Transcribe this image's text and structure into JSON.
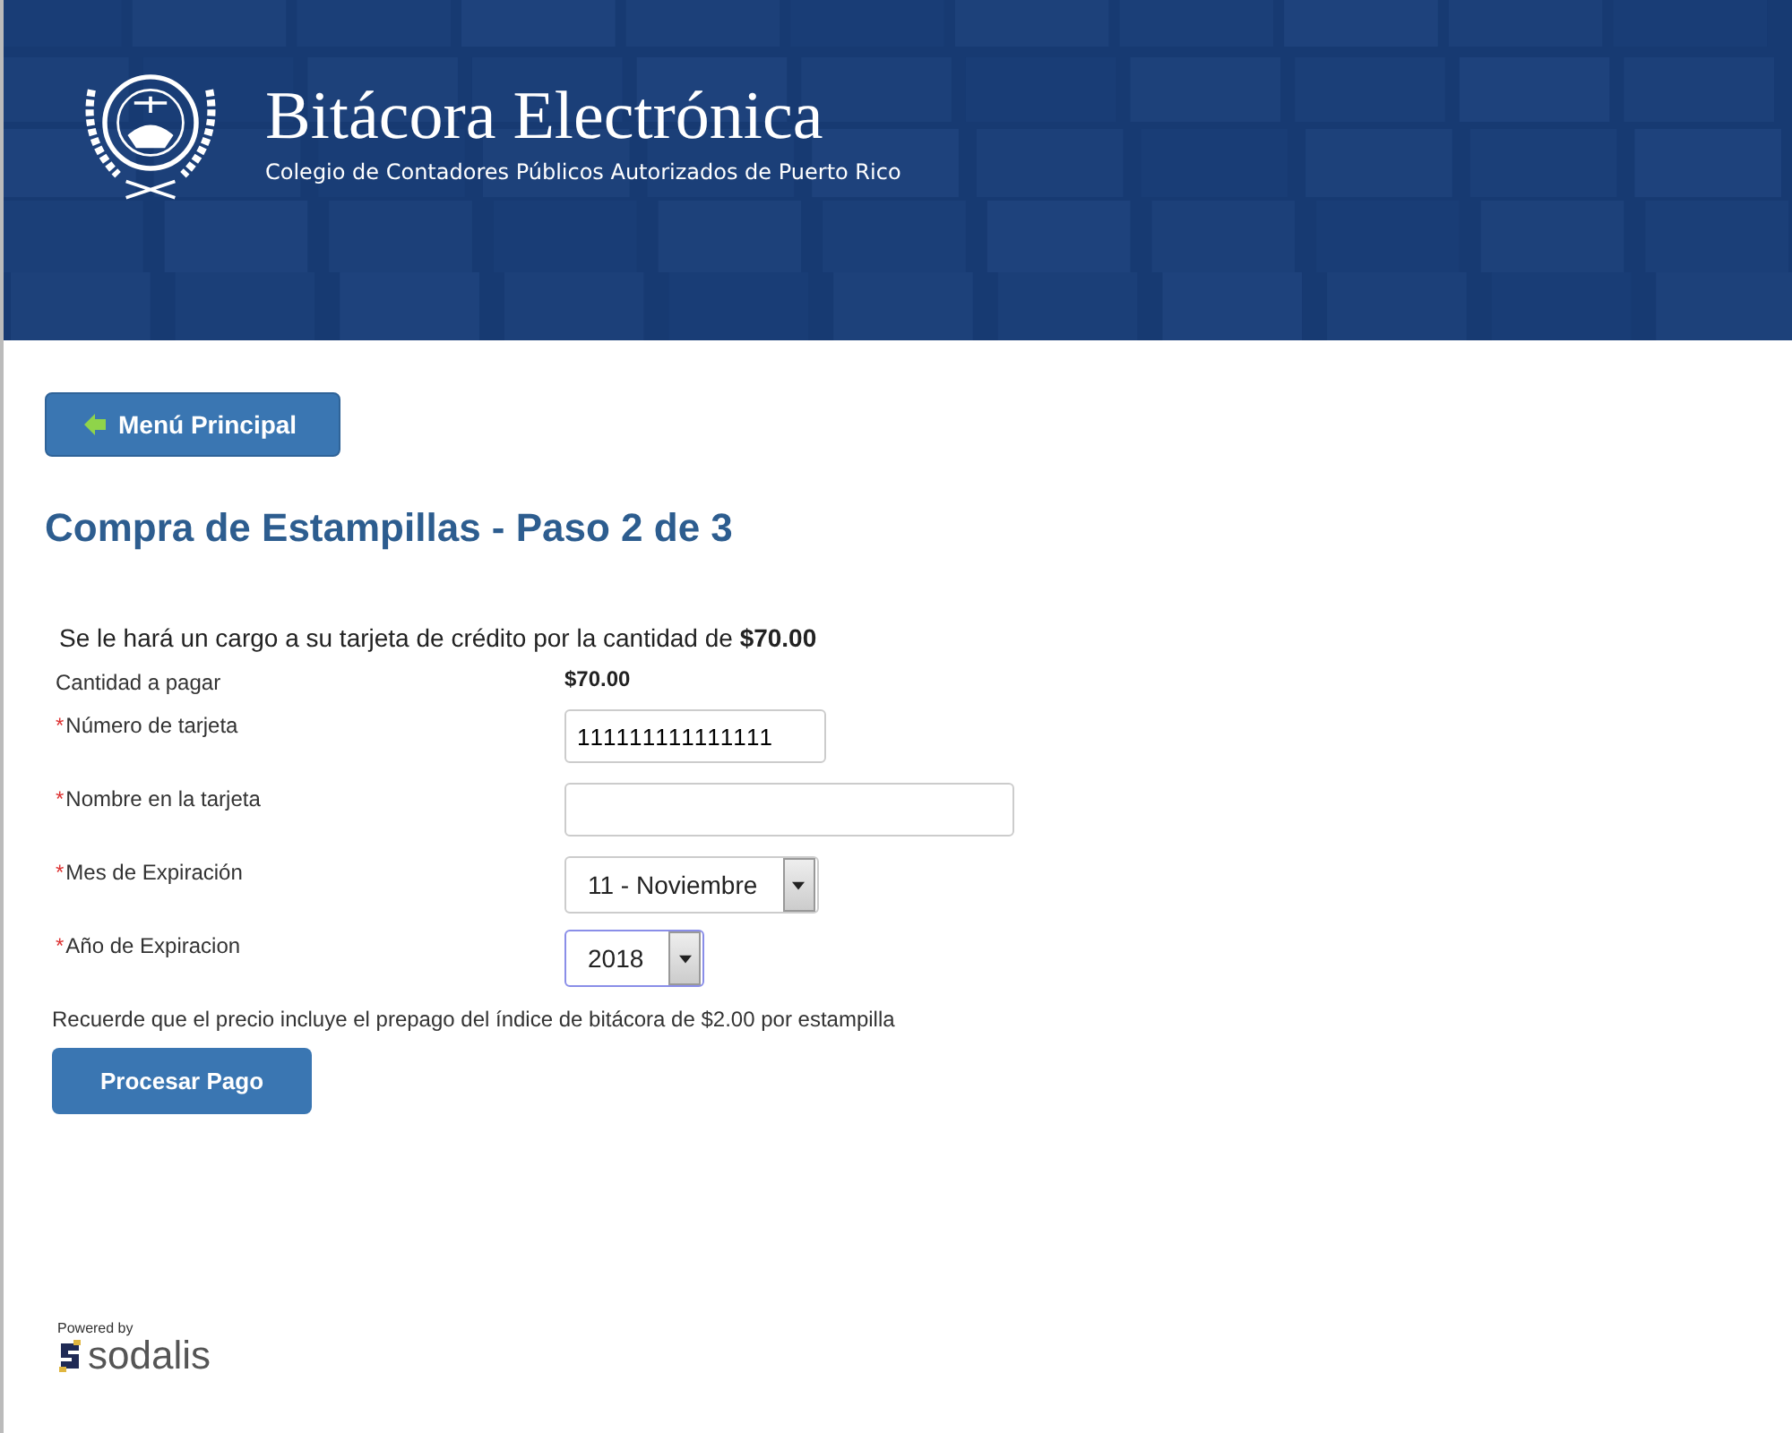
{
  "header": {
    "title": "Bitácora Electrónica",
    "subtitle": "Colegio de Contadores Públicos Autorizados de Puerto Rico"
  },
  "menu_button": {
    "label": "Menú Principal"
  },
  "heading": "Compra de Estampillas - Paso 2 de 3",
  "notice": "Se le hará un cargo a su tarjeta de crédito por la cantidad de **$70.00**",
  "fields": [
    {
      "kind": "static",
      "label": "Cantidad a pagar",
      "value": "$70.00"
    },
    {
      "kind": "text",
      "mark": "*",
      "label": "Número de tarjeta",
      "value": "111111111111111",
      "wide": false,
      "focused": false
    },
    {
      "kind": "text",
      "mark": "*",
      "label": "Nombre en la tarjeta",
      "wide": true,
      "focused": false
    },
    {
      "kind": "select",
      "mark": "*",
      "label": "Mes de Expiración",
      "value": "11 - Noviembre",
      "focused": false
    },
    {
      "kind": "select",
      "mark": "*",
      "label": "Año de Expiracion",
      "value": "2018",
      "focused": true
    }
  ],
  "note": "Recuerde que el precio incluye el prepago del índice de bitácora de $2.00 por estampilla",
  "submit_button": {
    "label": "Procesar Pago"
  },
  "footer": {
    "powered_by": "Powered by",
    "brand": "sodalis"
  }
}
